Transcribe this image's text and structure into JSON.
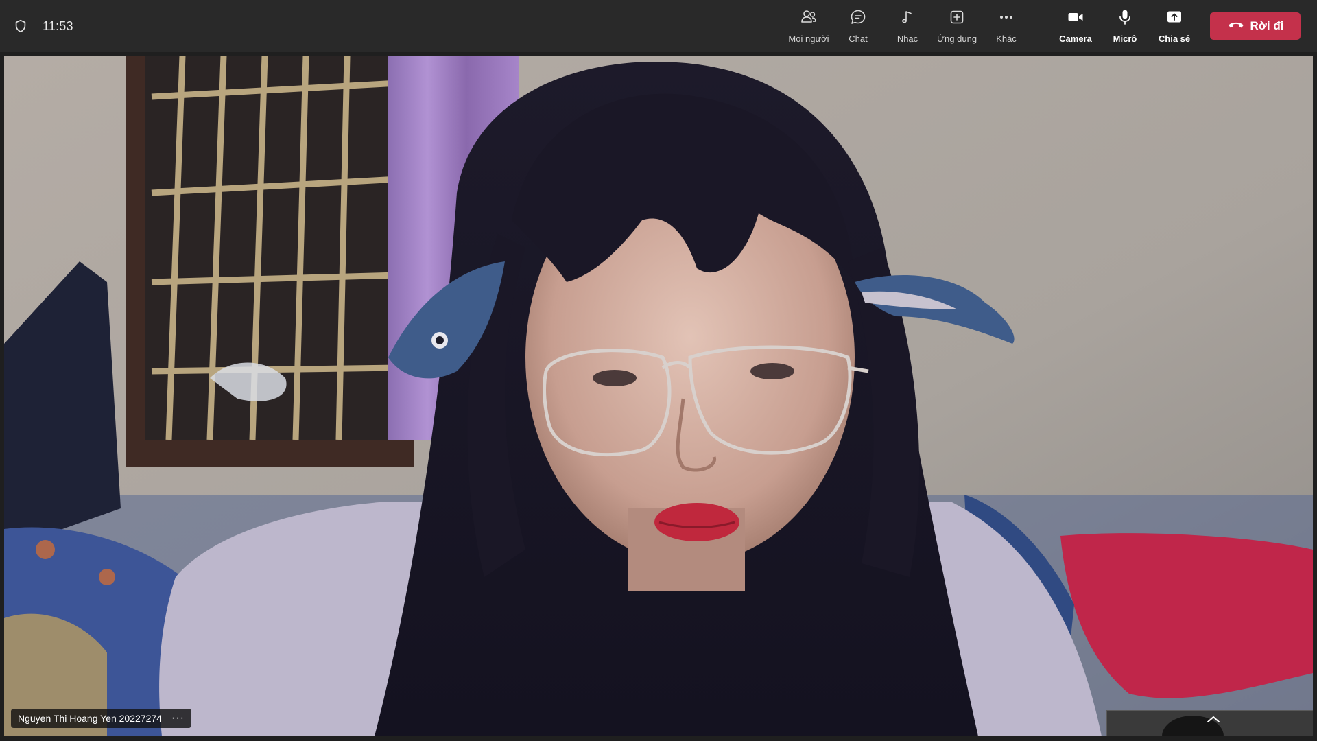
{
  "meeting": {
    "clock": "11:53",
    "participant_name": "Nguyen Thi Hoang Yen 20227274",
    "participant_more": "···"
  },
  "toolbar": {
    "people_label": "Mọi người",
    "chat_label": "Chat",
    "music_label": "Nhạc",
    "apps_label": "Ứng dụng",
    "more_label": "Khác",
    "camera_label": "Camera",
    "mic_label": "Micrô",
    "share_label": "Chia sẻ",
    "leave_label": "Rời đi"
  },
  "icons": {
    "shield": "shield-icon",
    "people": "people-icon",
    "chat": "chat-bubble-icon",
    "music": "music-note-icon",
    "apps": "add-app-icon",
    "more": "more-dots-icon",
    "camera": "video-camera-icon",
    "mic": "microphone-icon",
    "share": "share-upload-icon",
    "leave": "hang-up-phone-icon",
    "expand": "chevron-up-icon"
  },
  "colors": {
    "bar_background": "#292929",
    "leave_red": "#c4314b",
    "label_gray": "#d6d6d6"
  }
}
